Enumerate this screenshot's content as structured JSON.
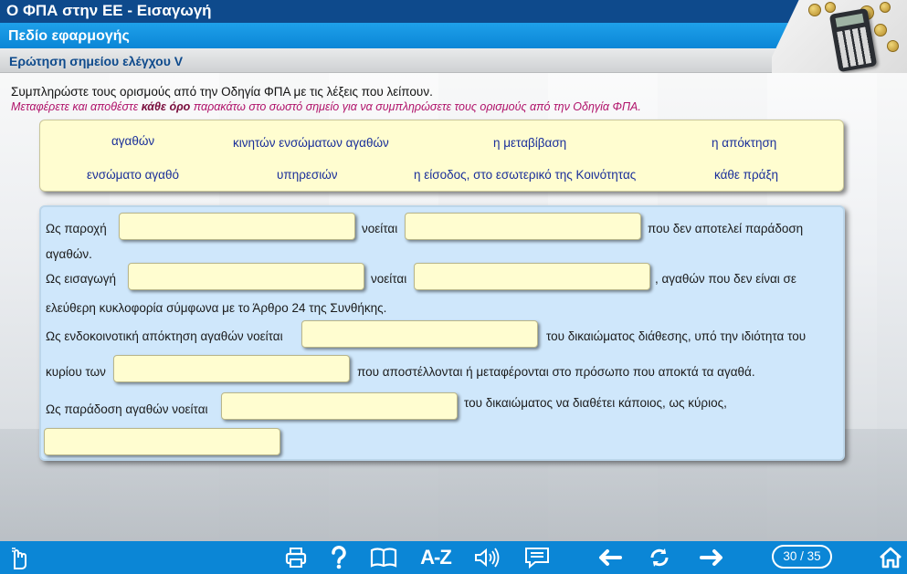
{
  "header": {
    "title": "Ο ΦΠΑ στην ΕΕ - Εισαγωγή",
    "section": "Πεδίο εφαρμογής",
    "subsection": "Ερώτηση σημείου ελέγχου V"
  },
  "instructions": {
    "line1": "Συμπληρώστε τους ορισμούς από την Οδηγία ΦΠΑ με τις λέξεις που λείπουν.",
    "line2_before": "Μεταφέρετε και αποθέστε ",
    "line2_bold": "κάθε όρο",
    "line2_after": " παρακάτω στο σωστό σημείο για να συμπληρώσετε τους ορισμούς από την Οδηγία ΦΠΑ."
  },
  "terms": [
    "αγαθών",
    "κινητών ενσώματων αγαθών",
    "η μεταβίβαση",
    "η απόκτηση",
    "ενσώματο αγαθό",
    "υπηρεσιών",
    "η είσοδος, στο εσωτερικό της Κοινότητας",
    "κάθε πράξη"
  ],
  "sentences": {
    "s1_a": "Ως παροχή",
    "s1_b": "νοείται",
    "s1_c": "που δεν αποτελεί παράδοση",
    "s1_d": "αγαθών.",
    "s2_a": "Ως εισαγωγή",
    "s2_b": "νοείται",
    "s2_c": ", αγαθών που δεν είναι σε",
    "s2_d": "ελεύθερη κυκλοφορία σύμφωνα με το Άρθρο 24 της Συνθήκης.",
    "s3_a": "Ως ενδοκοινοτική απόκτηση αγαθών νοείται",
    "s3_b": "του δικαιώματος διάθεσης, υπό την ιδιότητα του",
    "s3_c": "κυρίου των",
    "s3_d": "που αποστέλλονται ή μεταφέρονται στο πρόσωπο που αποκτά τα αγαθά.",
    "s4_a": "Ως παράδοση αγαθών νοείται",
    "s4_b": "του δικαιώματος να διαθέτει κάποιος, ως κύριος,"
  },
  "toolbar": {
    "glossary_label": "A-Z",
    "page_current": "30",
    "page_total": "35",
    "page_display": "30 / 35"
  },
  "colors": {
    "title_bar": "#0e4a8c",
    "section_bar": "#0b86d6",
    "term_text": "#1a2f9a",
    "slot_fill": "#fffdd0",
    "panel_fill": "#cfe7fb",
    "instruction_emphasis": "#b0126a"
  },
  "icons": [
    "hand-pointer-icon",
    "print-icon",
    "help-icon",
    "book-icon",
    "glossary-az-icon",
    "audio-icon",
    "transcript-icon",
    "back-arrow-icon",
    "replay-icon",
    "forward-arrow-icon",
    "home-icon"
  ]
}
